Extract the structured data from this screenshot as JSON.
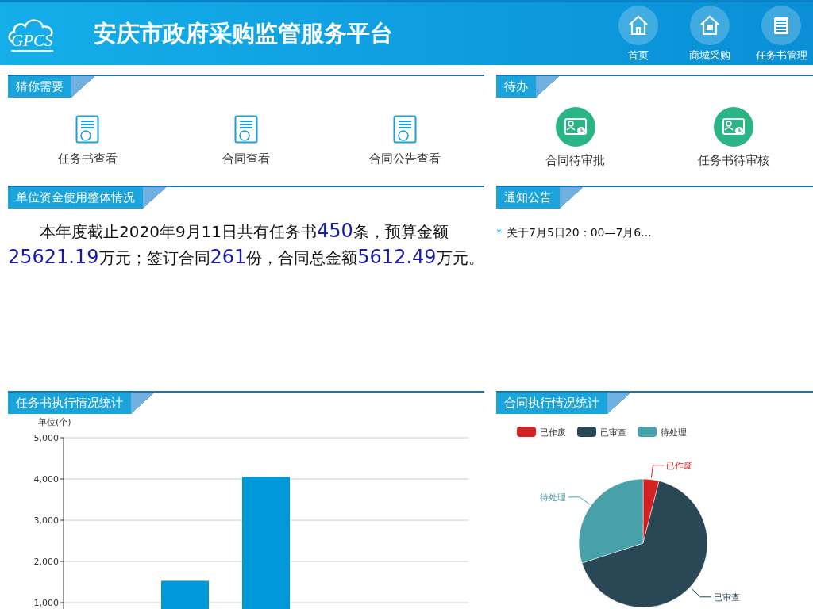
{
  "header": {
    "logo_text": "GPCS",
    "title": "安庆市政府采购监管服务平台",
    "nav": [
      {
        "label": "首页"
      },
      {
        "label": "商城采购"
      },
      {
        "label": "任务书管理"
      }
    ]
  },
  "guess": {
    "title": "猜你需要",
    "items": [
      {
        "label": "任务书查看"
      },
      {
        "label": "合同查看"
      },
      {
        "label": "合同公告查看"
      }
    ]
  },
  "todo": {
    "title": "待办",
    "items": [
      {
        "label": "合同待审批"
      },
      {
        "label": "任务书待审核"
      }
    ]
  },
  "funds": {
    "title": "单位资金使用整体情况",
    "segments": [
      {
        "text": "本年度截止2020年9月11日共有任务书",
        "highlight": false
      },
      {
        "text": "450",
        "highlight": true
      },
      {
        "text": "条，预算金额",
        "highlight": false
      },
      {
        "text": "25621.19",
        "highlight": true
      },
      {
        "text": "万元；签订合同",
        "highlight": false
      },
      {
        "text": "261",
        "highlight": true
      },
      {
        "text": "份，合同总金额",
        "highlight": false
      },
      {
        "text": "5612.49",
        "highlight": true
      },
      {
        "text": "万元。",
        "highlight": false
      }
    ]
  },
  "notices": {
    "title": "通知公告",
    "items": [
      {
        "bullet": "*",
        "text": "关于7月5日20：00—7月6..."
      }
    ]
  },
  "task_chart": {
    "title": "任务书执行情况统计",
    "chart_data": {
      "type": "bar",
      "ylabel": "单位(个)",
      "values": [
        null,
        1530,
        4050,
        null,
        null
      ],
      "ylim": [
        1000,
        5000
      ],
      "grid": true,
      "yticks": [
        {
          "value": 1000,
          "label": "1,000"
        },
        {
          "value": 2000,
          "label": "2,000"
        },
        {
          "value": 3000,
          "label": "3,000"
        },
        {
          "value": 4000,
          "label": "4,000"
        },
        {
          "value": 5000,
          "label": "5,000"
        }
      ],
      "color": "#0098d9"
    }
  },
  "contract_chart": {
    "title": "合同执行情况统计",
    "chart_data": {
      "type": "pie",
      "legend": "top-left",
      "categories": [
        "已作废",
        "已审查",
        "待处理"
      ],
      "values": [
        4,
        66,
        30
      ],
      "colors": [
        "#d32222",
        "#2a4755",
        "#48a0a8"
      ]
    }
  }
}
